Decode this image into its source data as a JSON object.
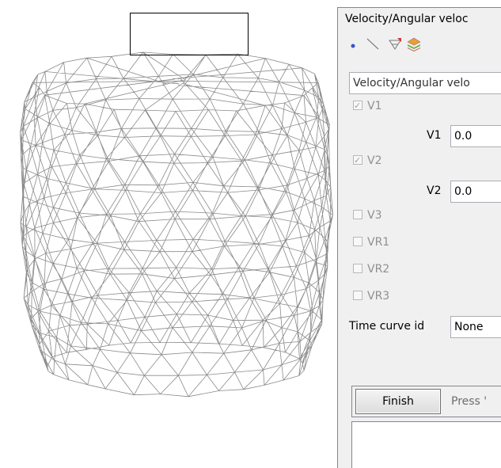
{
  "panel": {
    "title": "Velocity/Angular veloc",
    "toolbar_icons": [
      "point-icon",
      "line-icon",
      "mesh-select-icon",
      "layers-icon"
    ],
    "combo_value": "Velocity/Angular velo",
    "fields": [
      {
        "check_label": "V1",
        "checked": true,
        "field_label": "V1",
        "value": "0.0"
      },
      {
        "check_label": "V2",
        "checked": true,
        "field_label": "V2",
        "value": "0.0"
      }
    ],
    "extra_checks": [
      {
        "label": "V3",
        "checked": false
      },
      {
        "label": "VR1",
        "checked": false
      },
      {
        "label": "VR2",
        "checked": false
      },
      {
        "label": "VR3",
        "checked": false
      }
    ],
    "time_curve_label": "Time curve id",
    "time_curve_value": "None",
    "finish_label": "Finish",
    "hint_text": "Press '"
  }
}
